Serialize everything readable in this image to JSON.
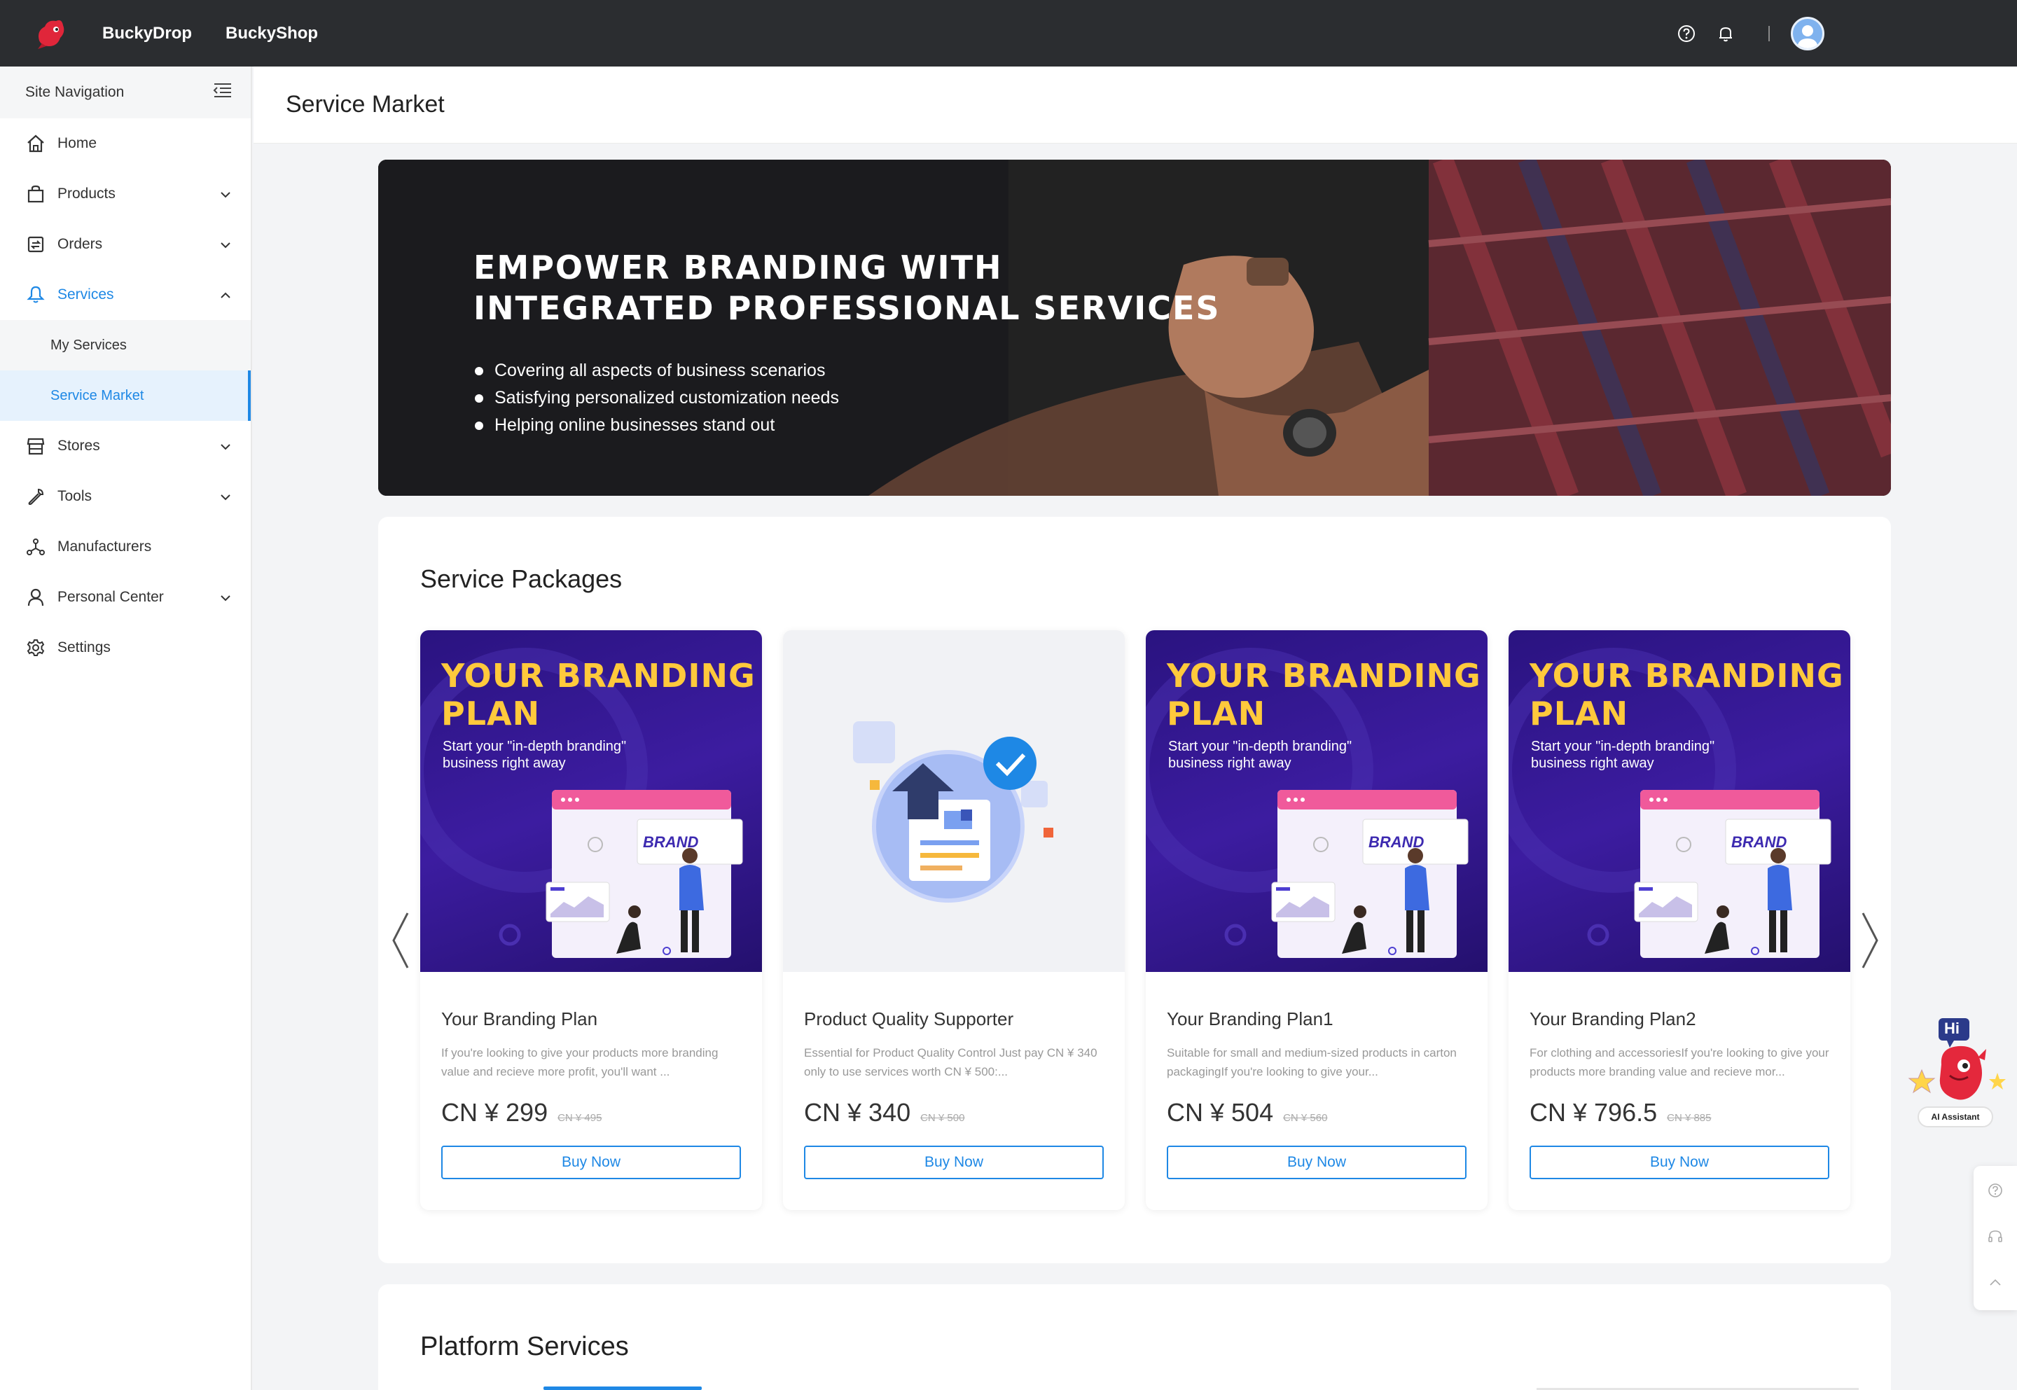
{
  "topbar": {
    "brand_links": [
      "BuckyDrop",
      "BuckyShop"
    ],
    "icons": [
      "help-icon",
      "bell-icon"
    ]
  },
  "sidebar": {
    "header": "Site Navigation",
    "items": [
      {
        "label": "Home",
        "icon": "home-icon"
      },
      {
        "label": "Products",
        "icon": "bag-icon"
      },
      {
        "label": "Orders",
        "icon": "orders-icon"
      },
      {
        "label": "Services",
        "icon": "services-icon"
      },
      {
        "label": "Stores",
        "icon": "store-icon"
      },
      {
        "label": "Tools",
        "icon": "wrench-icon"
      },
      {
        "label": "Manufacturers",
        "icon": "network-icon"
      },
      {
        "label": "Personal Center",
        "icon": "user-icon"
      },
      {
        "label": "Settings",
        "icon": "gear-icon"
      }
    ],
    "services_sub": [
      "My Services",
      "Service Market"
    ]
  },
  "page": {
    "title": "Service Market"
  },
  "banner": {
    "title_line1": "EMPOWER BRANDING WITH",
    "title_line2": "INTEGRATED PROFESSIONAL SERVICES",
    "points": [
      "Covering all aspects of business scenarios",
      "Satisfying personalized customization needs",
      "Helping online businesses stand out"
    ]
  },
  "packages": {
    "title": "Service Packages",
    "buy_label": "Buy Now",
    "plan_title_line1": "YOUR BRANDING",
    "plan_title_line2": "PLAN",
    "plan_sub": "Start your \"in-depth branding\" business right away",
    "brand_tag": "BRAND",
    "items": [
      {
        "name": "Your Branding Plan",
        "desc": "If you're looking to give your products more branding value and recieve more profit, you'll want ...",
        "price": "CN ¥ 299",
        "old_price": "CN ¥ 495"
      },
      {
        "name": "Product Quality Supporter",
        "desc": "Essential for Product Quality Control Just pay CN ¥ 340 only to use services worth CN ¥ 500:...",
        "price": "CN ¥ 340",
        "old_price": "CN ¥ 500"
      },
      {
        "name": "Your Branding Plan1",
        "desc": "Suitable for small and medium-sized products in carton packagingIf you're looking to give your...",
        "price": "CN ¥ 504",
        "old_price": "CN ¥ 560"
      },
      {
        "name": "Your Branding Plan2",
        "desc": "For clothing and accessoriesIf you're looking to give your products more branding value and recieve mor...",
        "price": "CN ¥ 796.5",
        "old_price": "CN ¥ 885"
      }
    ]
  },
  "platform": {
    "title": "Platform Services"
  },
  "assistant": {
    "bubble": "Hi",
    "label": "AI Assistant"
  }
}
